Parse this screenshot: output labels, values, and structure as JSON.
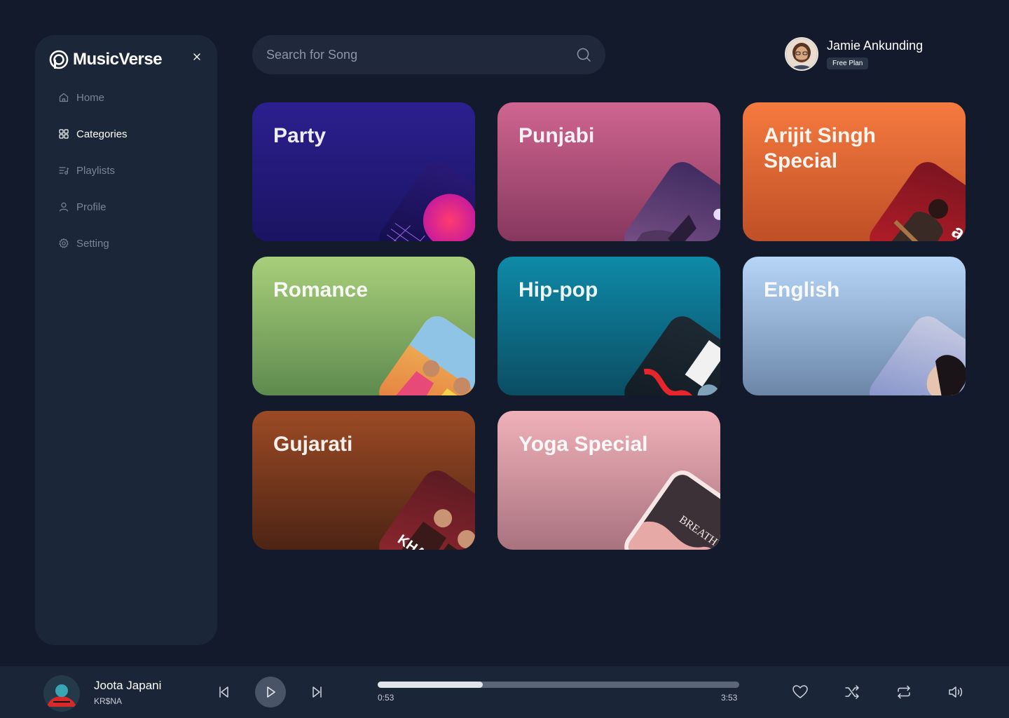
{
  "brand": {
    "name": "MusicVerse"
  },
  "sidebar": {
    "items": [
      {
        "label": "Home",
        "icon": "home-icon",
        "active": false
      },
      {
        "label": "Categories",
        "icon": "grid-icon",
        "active": true
      },
      {
        "label": "Playlists",
        "icon": "playlist-icon",
        "active": false
      },
      {
        "label": "Profile",
        "icon": "user-icon",
        "active": false
      },
      {
        "label": "Setting",
        "icon": "gear-icon",
        "active": false
      }
    ]
  },
  "search": {
    "placeholder": "Search for Song"
  },
  "user": {
    "name": "Jamie Ankunding",
    "plan": "Free Plan"
  },
  "categories": [
    {
      "title": "Party"
    },
    {
      "title": "Punjabi"
    },
    {
      "title": "Arijit Singh Special"
    },
    {
      "title": "Romance"
    },
    {
      "title": "Hip-pop"
    },
    {
      "title": "English"
    },
    {
      "title": "Gujarati"
    },
    {
      "title": "Yoga Special"
    }
  ],
  "player": {
    "title": "Joota Japani",
    "artist": "KR$NA",
    "elapsed": "0:53",
    "duration": "3:53",
    "progress": 0.29
  },
  "colors": {
    "background": "#121a2b",
    "panel": "#1c2639",
    "player_bar": "#1b2538"
  }
}
